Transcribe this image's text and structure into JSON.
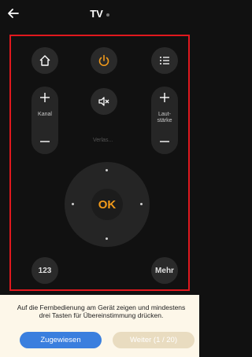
{
  "header": {
    "title": "TV",
    "back_icon": "arrow-left-icon"
  },
  "remote": {
    "channel_label": "Kanal",
    "volume_label_line1": "Laut-",
    "volume_label_line2": "stärke",
    "faded_label": "Verlas...",
    "ok_label": "OK",
    "numbers_label": "123",
    "more_label": "Mehr",
    "power_color": "#f29a1a",
    "highlight_color": "#e0181e"
  },
  "footer": {
    "instruction_line1": "Auf die Fernbedienung am Gerät zeigen und mindestens",
    "instruction_line2": "drei Tasten für Übereinstimmung drücken.",
    "assigned_label": "Zugewiesen",
    "next_label": "Weiter (1 / 20)"
  }
}
